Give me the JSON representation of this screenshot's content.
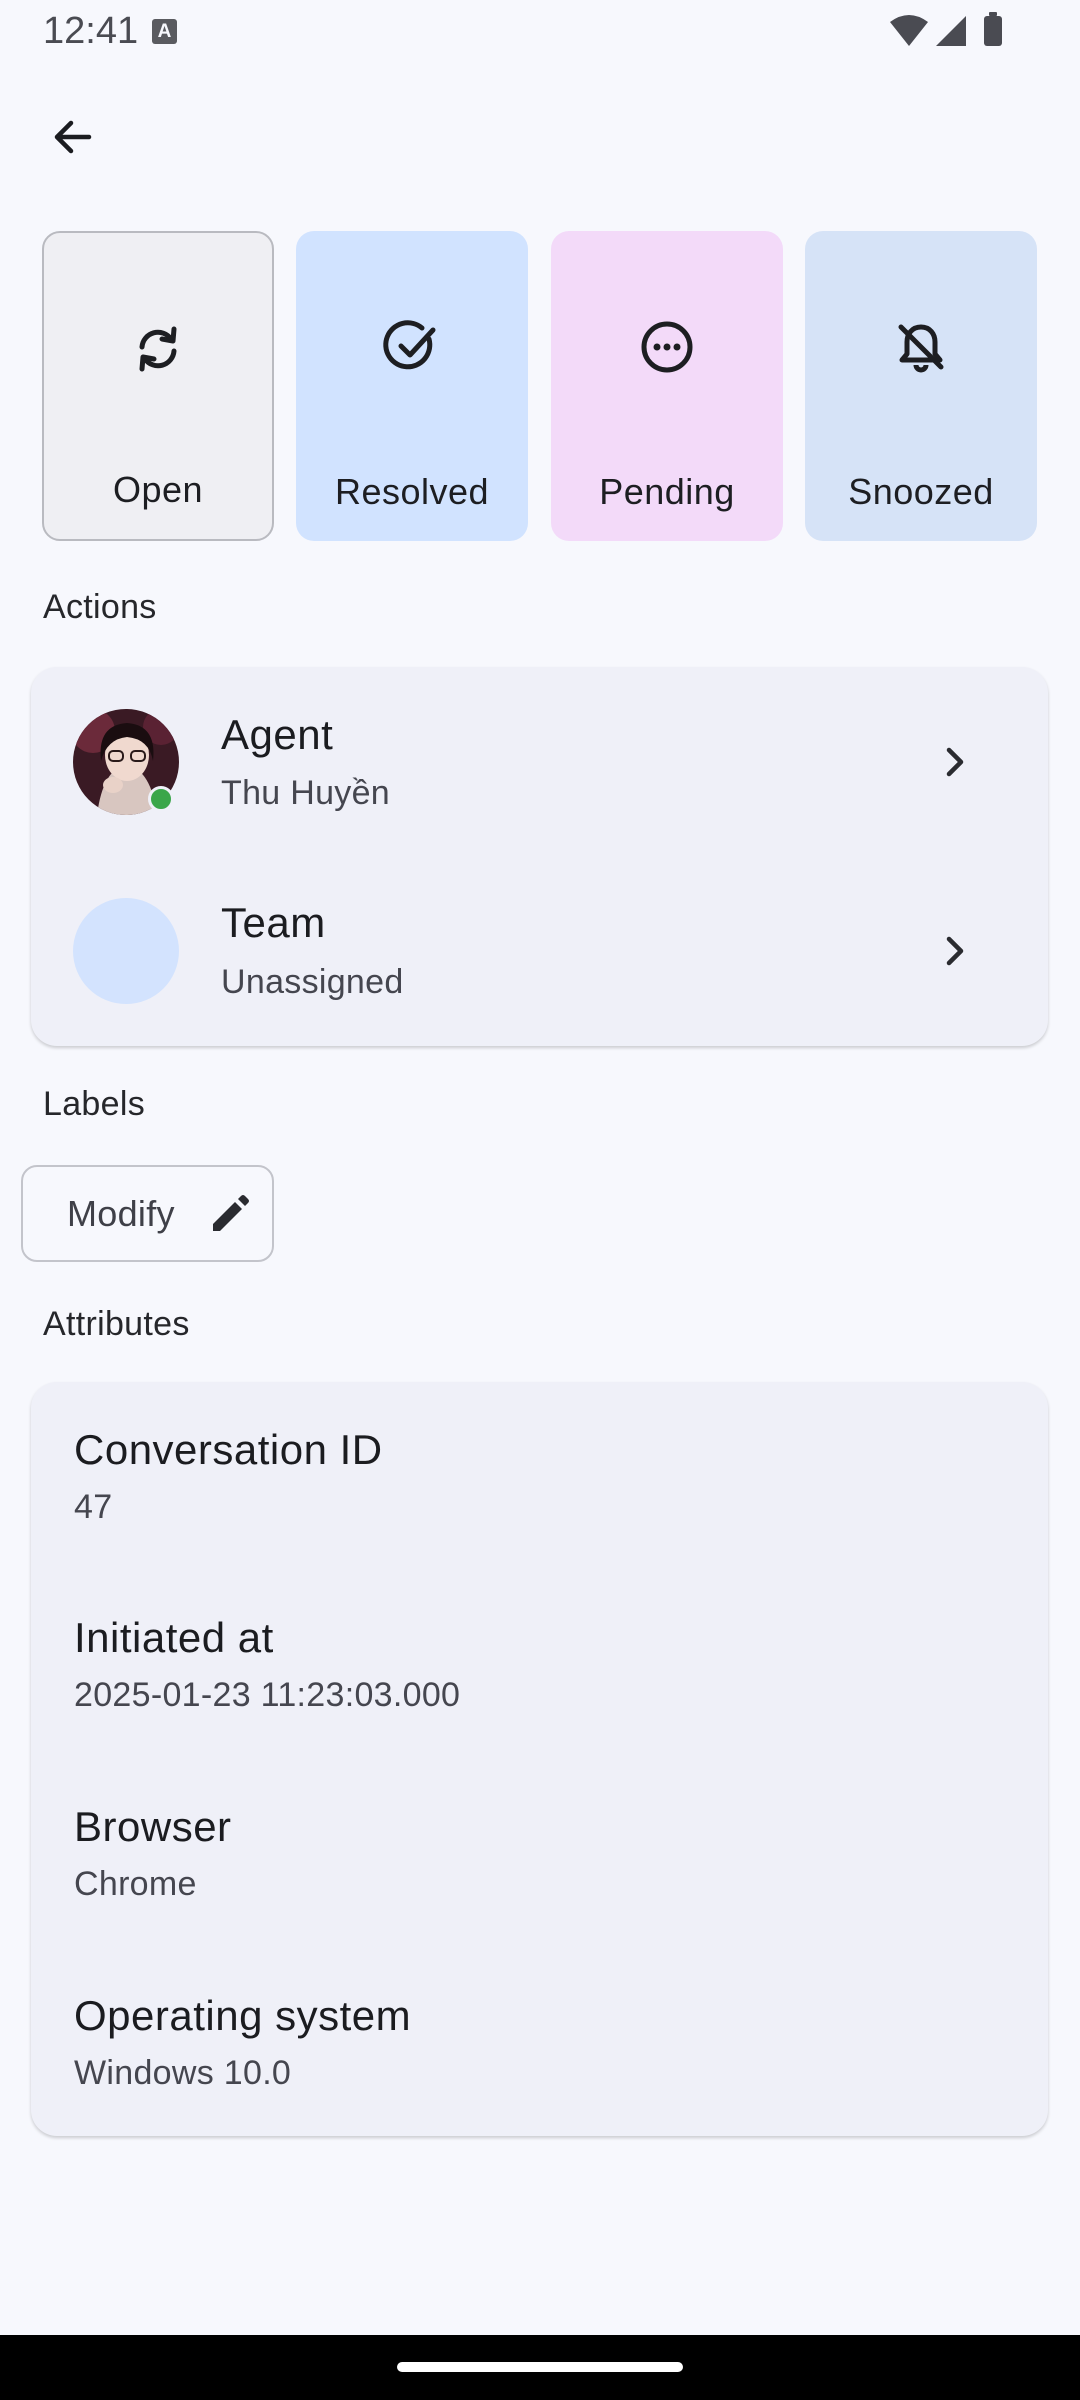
{
  "status_bar": {
    "time": "12:41",
    "indicator": "A",
    "icons": [
      "wifi-icon",
      "signal-icon",
      "battery-icon"
    ]
  },
  "nav": {
    "back_icon": "arrow-left-icon"
  },
  "status_tiles": [
    {
      "label": "Open",
      "icon": "sync-icon",
      "selected": true,
      "color": "#efeff3"
    },
    {
      "label": "Resolved",
      "icon": "check-circle-icon",
      "color": "#d1e3ff"
    },
    {
      "label": "Pending",
      "icon": "more-circle-icon",
      "color": "#f3daf9"
    },
    {
      "label": "Snoozed",
      "icon": "bell-off-icon",
      "color": "#d6e3f7"
    }
  ],
  "actions": {
    "heading": "Actions",
    "agent": {
      "title": "Agent",
      "value": "Thu Huyền",
      "online": true
    },
    "team": {
      "title": "Team",
      "value": "Unassigned"
    }
  },
  "labels": {
    "heading": "Labels",
    "modify_label": "Modify"
  },
  "attributes": {
    "heading": "Attributes",
    "items": [
      {
        "title": "Conversation ID",
        "value": "47"
      },
      {
        "title": "Initiated at",
        "value": "2025-01-23 11:23:03.000"
      },
      {
        "title": "Browser",
        "value": "Chrome"
      },
      {
        "title": "Operating system",
        "value": "Windows 10.0"
      }
    ]
  },
  "colors": {
    "background": "#f7f8fd",
    "card": "#eff0f8",
    "online": "#3aa64a"
  }
}
